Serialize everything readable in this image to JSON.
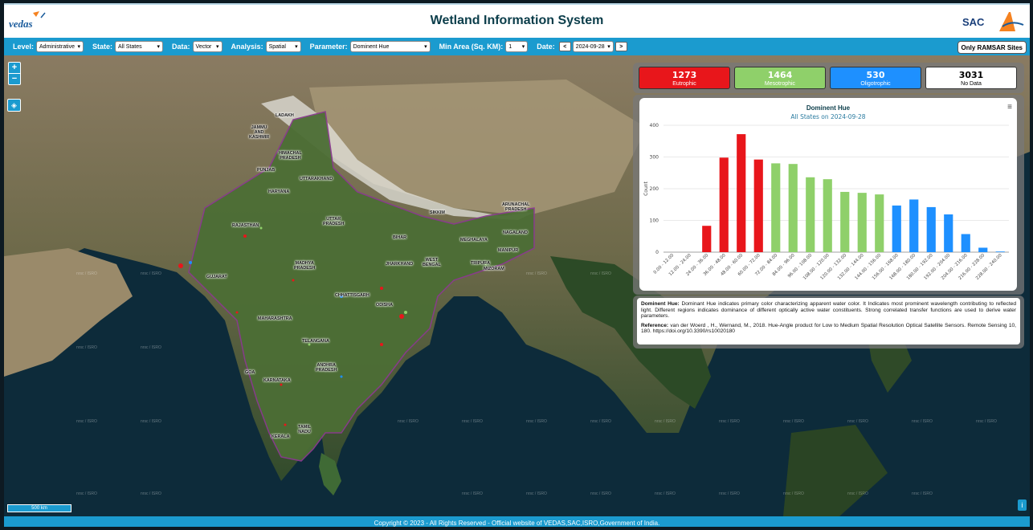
{
  "header": {
    "logo_text": "VEDAS",
    "title": "Wetland Information System",
    "right_logo_text": "SAC"
  },
  "toolbar": {
    "level_label": "Level:",
    "level_value": "Administrative",
    "state_label": "State:",
    "state_value": "All States",
    "data_label": "Data:",
    "data_value": "Vector",
    "analysis_label": "Analysis:",
    "analysis_value": "Spatial",
    "parameter_label": "Parameter:",
    "parameter_value": "Dominent Hue",
    "min_area_label": "Min Area (Sq. KM):",
    "min_area_value": "1",
    "date_label": "Date:",
    "prev_label": "<",
    "date_value": "2024-09-28",
    "next_label": ">",
    "ramsar_label": "Only RAMSAR Sites"
  },
  "map": {
    "zoom_in": "+",
    "zoom_out": "−",
    "scale_label": "500 km",
    "info_label": "i",
    "watermark": "nrsc / ISRO",
    "states": [
      "LADAKH",
      "JAMMU\nAND\nKASHMIR",
      "HIMACHAL\nPRADESH",
      "PUNJAB",
      "UTTARAKHAND",
      "HARYANA",
      "RAJASTHAN",
      "UTTAR\nPRADESH",
      "BIHAR",
      "SIKKIM",
      "ARUNACHAL\nPRADESH",
      "NAGALAND",
      "MEGHALAYA",
      "MANIPUR",
      "TRIPURA",
      "MIZORAM",
      "WEST\nBENGAL",
      "JHARKHAND",
      "MADHYA\nPRADESH",
      "GUJARAT",
      "CHHATTISGARH",
      "ODISHA",
      "MAHARASHTRA",
      "TELANGANA",
      "ANDHRA\nPRADESH",
      "GOA",
      "KARNATAKA",
      "TAMIL\nNADU",
      "KERALA"
    ]
  },
  "summary": {
    "cards": [
      {
        "value": "1273",
        "label": "Eutrophic",
        "color": "#e8161b"
      },
      {
        "value": "1464",
        "label": "Mesotrophic",
        "color": "#8fd06a"
      },
      {
        "value": "530",
        "label": "Oligotrophic",
        "color": "#1e90ff"
      },
      {
        "value": "3031",
        "label": "No Data",
        "color": "#ffffff"
      }
    ]
  },
  "chart_data": {
    "type": "bar",
    "title": "Dominent Hue",
    "subtitle": "All States on 2024-09-28",
    "ylabel": "Count",
    "xlabel": "",
    "ylim": [
      0,
      400
    ],
    "yticks": [
      0,
      100,
      200,
      300,
      400
    ],
    "categories": [
      "0.00 - 12.00",
      "12.00 - 24.00",
      "24.00 - 36.00",
      "36.00 - 48.00",
      "48.00 - 60.00",
      "60.00 - 72.00",
      "72.00 - 84.00",
      "84.00 - 96.00",
      "96.00 - 108.00",
      "108.00 - 120.00",
      "120.00 - 132.00",
      "132.00 - 144.00",
      "144.00 - 156.00",
      "156.00 - 168.00",
      "168.00 - 180.00",
      "180.00 - 192.00",
      "192.00 - 204.00",
      "204.00 - 216.00",
      "216.00 - 228.00",
      "228.00 - 240.00"
    ],
    "values": [
      0,
      0,
      83,
      298,
      372,
      292,
      280,
      278,
      236,
      230,
      190,
      187,
      182,
      147,
      166,
      142,
      119,
      57,
      14,
      1
    ],
    "colors": [
      "#e8161b",
      "#e8161b",
      "#e8161b",
      "#e8161b",
      "#e8161b",
      "#e8161b",
      "#8fd06a",
      "#8fd06a",
      "#8fd06a",
      "#8fd06a",
      "#8fd06a",
      "#8fd06a",
      "#8fd06a",
      "#1e90ff",
      "#1e90ff",
      "#1e90ff",
      "#1e90ff",
      "#1e90ff",
      "#1e90ff",
      "#1e90ff"
    ],
    "grid": true,
    "legend": "none"
  },
  "description": {
    "term": "Dominent Hue:",
    "text": "Dominant Hue indicates primary color characterizing apparent water color. It Indicates most prominent wavelength contributing to reflected light. Different regions indicates dominance of different optically active water constituents. Strong correlated transfer functions are used to derive water parameters.",
    "ref_label": "Reference:",
    "ref_text": "van der Woerd , H., Wernand, M., 2018. Hue-Angle product for Low to Medium Spatial Resolution Optical Satellite Sensors. Remote Sensing 10, 180. https://doi.org/10.3390/rs10020180"
  },
  "footer": {
    "text": "Copyright © 2023 - All Rights Reserved - Official website of VEDAS,SAC,ISRO,Government of India."
  }
}
